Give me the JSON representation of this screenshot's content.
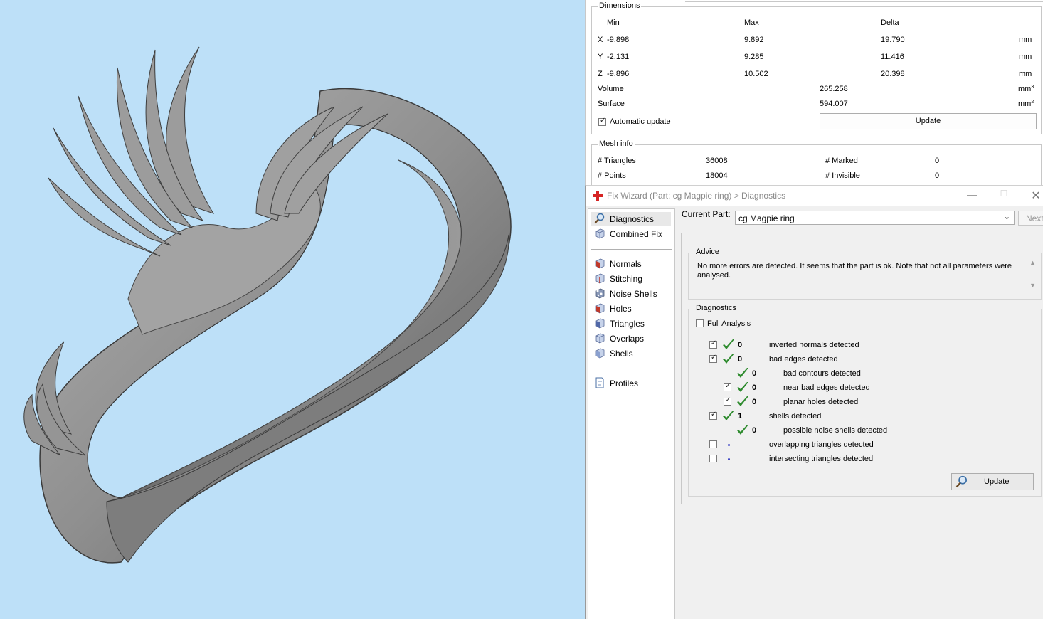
{
  "dimensions": {
    "title": "Dimensions",
    "headers": {
      "min": "Min",
      "max": "Max",
      "delta": "Delta"
    },
    "rows": [
      {
        "axis": "X",
        "min": "-9.898",
        "max": "9.892",
        "delta": "19.790",
        "unit": "mm"
      },
      {
        "axis": "Y",
        "min": "-2.131",
        "max": "9.285",
        "delta": "11.416",
        "unit": "mm"
      },
      {
        "axis": "Z",
        "min": "-9.896",
        "max": "10.502",
        "delta": "20.398",
        "unit": "mm"
      }
    ],
    "volume_label": "Volume",
    "volume_value": "265.258",
    "volume_unit": "mm",
    "volume_unit_sup": "3",
    "surface_label": "Surface",
    "surface_value": "594.007",
    "surface_unit": "mm",
    "surface_unit_sup": "2",
    "auto_update_label": "Automatic update",
    "auto_update_checked": true,
    "update_button": "Update"
  },
  "mesh_info": {
    "title": "Mesh info",
    "triangles_label": "# Triangles",
    "triangles_value": "36008",
    "points_label": "# Points",
    "points_value": "18004",
    "marked_label": "# Marked",
    "marked_value": "0",
    "invisible_label": "# Invisible",
    "invisible_value": "0"
  },
  "wizard": {
    "title": "Fix Wizard (Part: cg Magpie ring) > Diagnostics",
    "nav": {
      "top": [
        {
          "label": "Diagnostics",
          "icon": "magnifier-icon",
          "selected": true
        },
        {
          "label": "Combined Fix",
          "icon": "cube-icon",
          "selected": false
        }
      ],
      "tools": [
        {
          "label": "Normals",
          "icon": "normals-cube-icon"
        },
        {
          "label": "Stitching",
          "icon": "stitching-cube-icon"
        },
        {
          "label": "Noise Shells",
          "icon": "noise-shells-icon"
        },
        {
          "label": "Holes",
          "icon": "holes-cube-icon"
        },
        {
          "label": "Triangles",
          "icon": "triangles-cube-icon"
        },
        {
          "label": "Overlaps",
          "icon": "overlaps-cube-icon"
        },
        {
          "label": "Shells",
          "icon": "shells-cube-icon"
        }
      ],
      "bottom": [
        {
          "label": "Profiles",
          "icon": "document-icon"
        }
      ]
    },
    "current_part_label": "Current Part:",
    "current_part_value": "cg Magpie ring",
    "next_button": "Next",
    "advice_title": "Advice",
    "advice_text": "No more errors are detected. It seems that the part is ok. Note that not all parameters were analysed.",
    "diagnostics_title": "Diagnostics",
    "full_analysis_label": "Full Analysis",
    "full_analysis_checked": false,
    "rows": [
      {
        "level": 0,
        "checkbox": true,
        "checked": true,
        "status": "ok",
        "count": "0",
        "label": "inverted normals detected"
      },
      {
        "level": 0,
        "checkbox": true,
        "checked": true,
        "status": "ok",
        "count": "0",
        "label": "bad edges detected"
      },
      {
        "level": 1,
        "checkbox": false,
        "checked": false,
        "status": "ok",
        "count": "0",
        "label": "bad contours detected"
      },
      {
        "level": 1,
        "checkbox": true,
        "checked": true,
        "status": "ok",
        "count": "0",
        "label": "near bad edges detected"
      },
      {
        "level": 1,
        "checkbox": true,
        "checked": true,
        "status": "ok",
        "count": "0",
        "label": "planar holes detected"
      },
      {
        "level": 0,
        "checkbox": true,
        "checked": true,
        "status": "ok",
        "count": "1",
        "label": "shells detected"
      },
      {
        "level": 1,
        "checkbox": false,
        "checked": false,
        "status": "ok",
        "count": "0",
        "label": "possible noise shells detected"
      },
      {
        "level": 0,
        "checkbox": true,
        "checked": false,
        "status": "pending",
        "count": "",
        "label": "overlapping triangles detected"
      },
      {
        "level": 0,
        "checkbox": true,
        "checked": false,
        "status": "pending",
        "count": "",
        "label": "intersecting triangles detected"
      }
    ],
    "update_button": "Update"
  },
  "colors": {
    "viewport_bg": "#bde0f8",
    "model_gray": "#8c8c8c",
    "tick_green": "#2e8b2e",
    "pending_dot": "#3b43c4"
  }
}
